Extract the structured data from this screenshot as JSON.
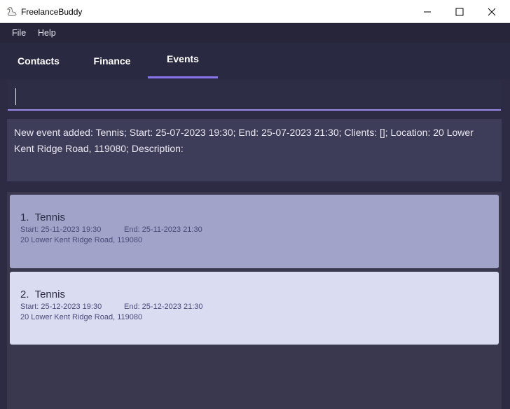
{
  "window": {
    "title": "FreelanceBuddy"
  },
  "menu": {
    "items": [
      {
        "label": "File"
      },
      {
        "label": "Help"
      }
    ]
  },
  "tabs": [
    {
      "label": "Contacts"
    },
    {
      "label": "Finance"
    },
    {
      "label": "Events",
      "active": true
    }
  ],
  "command": {
    "value": ""
  },
  "result": {
    "message": "New event added: Tennis; Start: 25-07-2023 19:30; End: 25-07-2023 21:30; Clients: []; Location: 20 Lower Kent Ridge Road, 119080; Description:"
  },
  "events": [
    {
      "index": "1.",
      "name": "Tennis",
      "start": "Start: 25-11-2023 19:30",
      "end": "End: 25-11-2023 21:30",
      "location": "20 Lower Kent Ridge Road, 119080",
      "selected": true
    },
    {
      "index": "2.",
      "name": "Tennis",
      "start": "Start: 25-12-2023 19:30",
      "end": "End: 25-12-2023 21:30",
      "location": "20 Lower Kent Ridge Road, 119080",
      "selected": false
    }
  ],
  "colors": {
    "accent": "#8a74f0",
    "selected_card": "#a1a3c9",
    "card": "#dadcf2",
    "background": "#2c2b43"
  },
  "icons": {
    "app": "goose-icon",
    "minimize": "minimize-icon",
    "maximize": "maximize-icon",
    "close": "close-icon"
  }
}
